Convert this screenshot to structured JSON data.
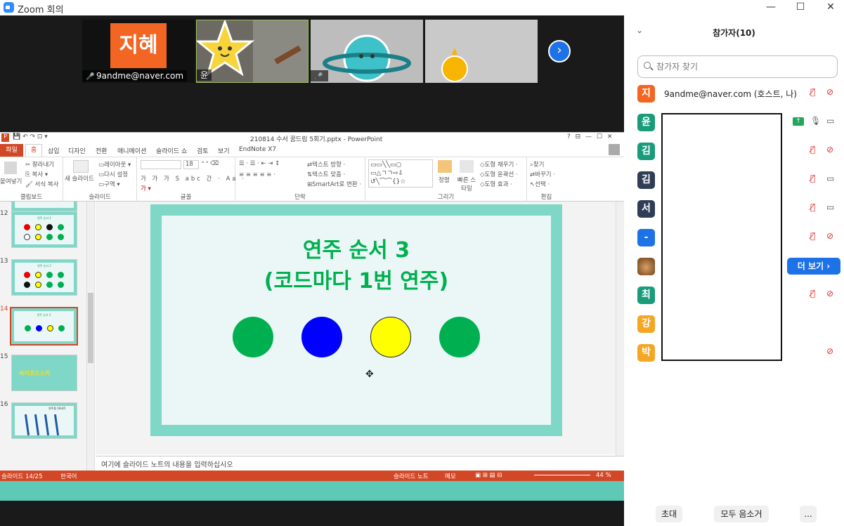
{
  "window": {
    "title": "Zoom 회의",
    "minimize": "—",
    "maximize": "☐",
    "close": "✕"
  },
  "gallery": {
    "tiles": [
      {
        "avatar": "지혜",
        "name": "9andme@naver.com"
      },
      {
        "name": "윤"
      },
      {
        "name": ""
      },
      {
        "name": ""
      }
    ],
    "next_label": "›"
  },
  "ppt": {
    "filetitle": "210814 수서 꿈드림 5회기.pptx - PowerPoint",
    "title_controls": "?  ⊟  —  ☐  ✕",
    "tabs": [
      "파일",
      "홈",
      "삽입",
      "디자인",
      "전환",
      "애니메이션",
      "슬라이드 쇼",
      "검토",
      "보기",
      "EndNote X7"
    ],
    "ribbon": {
      "clipboard": {
        "label": "클립보드",
        "paste": "붙여넣기",
        "cut": "잘라내기",
        "copy": "복사",
        "format": "서식 복사"
      },
      "slides": {
        "label": "슬라이드",
        "new": "새 슬라이드",
        "layout": "레이아웃",
        "reset": "다시 설정",
        "section": "구역"
      },
      "font": {
        "label": "글꼴",
        "size": "18"
      },
      "paragraph": {
        "label": "단락",
        "text_dir": "텍스트 방향",
        "align_text": "텍스트 맞춤",
        "smartart": "SmartArt로 변환"
      },
      "drawing": {
        "label": "그리기",
        "arrange": "정렬",
        "quick_styles": "빠른 스타일",
        "fill": "도형 채우기",
        "outline": "도형 윤곽선",
        "effects": "도형 효과"
      },
      "editing": {
        "label": "편집",
        "find": "찾기",
        "replace": "바꾸기",
        "select": "선택"
      }
    },
    "thumbs": [
      {
        "num": "12",
        "title": "연주 순서 1"
      },
      {
        "num": "13",
        "title": "연주 순서 2"
      },
      {
        "num": "14",
        "title": "연주 순서 3"
      },
      {
        "num": "15",
        "title": "씨이코드스키"
      },
      {
        "num": "16",
        "title": "연주용 16비트"
      }
    ],
    "slide": {
      "title_line1": "연주 순서 3",
      "title_line2": "(코드마다 1번 연주)",
      "circles": [
        "#00b050",
        "#0000ff",
        "#ffff00",
        "#00b050"
      ]
    },
    "notes_placeholder": "여기에 슬라이드 노트의 내용을 입력하십시오",
    "status": {
      "slide": "슬라이드 14/25",
      "lang": "한국어",
      "notes": "슬라이드 노트",
      "comments": "메모",
      "zoom": "44 %"
    }
  },
  "panel": {
    "title": "참가자(10)",
    "search_placeholder": "참가자 찾기",
    "participants": [
      {
        "avatar": "지혜",
        "color": "#f26522",
        "name": "9andme@naver.com (호스트, 나)",
        "mic": "off",
        "cam": "off"
      },
      {
        "avatar": "윤",
        "color": "#1a9c7a",
        "name": "",
        "mic": "on",
        "cam": "on",
        "sharing": true
      },
      {
        "avatar": "김",
        "color": "#1a9c7a",
        "name": "",
        "mic": "off",
        "cam": "off"
      },
      {
        "avatar": "김",
        "color": "#2f3e57",
        "name": "",
        "mic": "off",
        "cam": "on"
      },
      {
        "avatar": "서",
        "color": "#2f3e57",
        "name": "",
        "mic": "off",
        "cam": "on"
      },
      {
        "avatar": "-",
        "color": "#1e72e8",
        "name": "",
        "mic": "off",
        "cam": "off"
      },
      {
        "avatar": "",
        "color": "#8a5a2b",
        "name": "",
        "mic": "",
        "cam": ""
      },
      {
        "avatar": "최",
        "color": "#1a9c7a",
        "name": "",
        "mic": "off",
        "cam": "off"
      },
      {
        "avatar": "강",
        "color": "#f5a623",
        "name": "",
        "mic": "",
        "cam": ""
      },
      {
        "avatar": "박",
        "color": "#f5a623",
        "name": "",
        "mic": "",
        "cam": "off"
      }
    ],
    "more_label": "더 보기 ›",
    "invite": "초대",
    "mute_all": "모두 음소거",
    "ellipsis": "..."
  }
}
